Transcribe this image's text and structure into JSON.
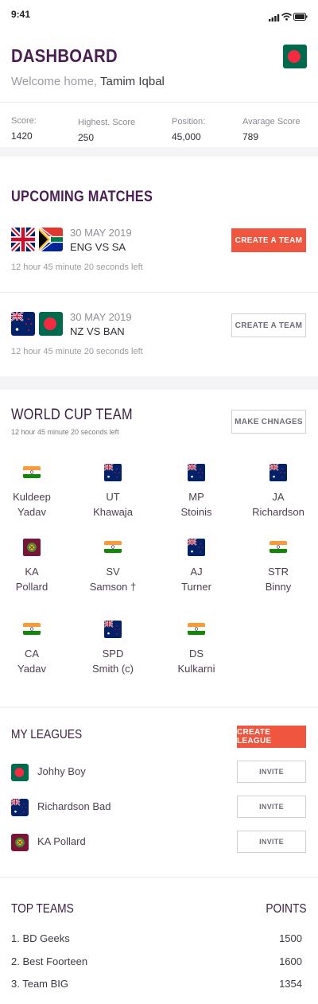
{
  "status_bar": {
    "time": "9:41"
  },
  "header": {
    "title": "DASHBOARD",
    "welcome": "Welcome home,",
    "user_name": "Tamim Iqbal"
  },
  "stats": [
    {
      "label": "Score:",
      "value": "1420"
    },
    {
      "label": "Highest. Score",
      "value": "250"
    },
    {
      "label": "Position:",
      "value": "45,000"
    },
    {
      "label": "Avarage Score",
      "value": "789"
    }
  ],
  "upcoming": {
    "title": "UPCOMING MATCHES",
    "matches": [
      {
        "date": "30 MAY 2019",
        "teams": "ENG VS SA",
        "countdown": "12 hour 45 minute 20 seconds left",
        "button": "CREATE A TEAM",
        "button_style": "solid"
      },
      {
        "date": "30 MAY 2019",
        "teams": "NZ VS BAN",
        "countdown": "12 hour 45 minute 20 seconds left",
        "button": "CREATE A TEAM",
        "button_style": "outline"
      }
    ]
  },
  "world_cup": {
    "title": "WORLD CUP TEAM",
    "countdown": "12 hour 45 minute 20 seconds left",
    "button": "MAKE CHNAGES",
    "players": [
      {
        "line1": "Kuldeep",
        "line2": "Yadav",
        "flag": "india"
      },
      {
        "line1": "UT",
        "line2": "Khawaja",
        "flag": "australia"
      },
      {
        "line1": "MP",
        "line2": "Stoinis",
        "flag": "australia"
      },
      {
        "line1": "JA",
        "line2": "Richardson",
        "flag": "australia"
      },
      {
        "line1": "KA",
        "line2": "Pollard",
        "flag": "west-indies"
      },
      {
        "line1": "SV",
        "line2": "Samson †",
        "flag": "india"
      },
      {
        "line1": "AJ",
        "line2": "Turner",
        "flag": "australia"
      },
      {
        "line1": "STR",
        "line2": "Binny",
        "flag": "india"
      },
      {
        "line1": "CA",
        "line2": "Yadav",
        "flag": "india"
      },
      {
        "line1": "SPD",
        "line2": "Smith (c)",
        "flag": "australia"
      },
      {
        "line1": "DS",
        "line2": "Kulkarni",
        "flag": "india"
      }
    ]
  },
  "leagues": {
    "title": "MY LEAGUES",
    "button": "CREATE LEAGUE",
    "items": [
      {
        "name": "Johhy Boy",
        "flag": "bangladesh",
        "button": "INVITE"
      },
      {
        "name": "Richardson Bad",
        "flag": "australia",
        "button": "INVITE"
      },
      {
        "name": "KA Pollard",
        "flag": "west-indies",
        "button": "INVITE"
      }
    ]
  },
  "top_teams": {
    "title": "TOP TEAMS",
    "points_label": "POINTS",
    "items": [
      {
        "name": "1. BD Geeks",
        "points": "1500"
      },
      {
        "name": "2. Best Foorteen",
        "points": "1600"
      },
      {
        "name": "3. Team BIG",
        "points": "1354"
      }
    ]
  },
  "colors": {
    "brand": "#4a1f52",
    "accent": "#f0563f",
    "bangladesh_green": "#006a4e",
    "bangladesh_red": "#f42a41"
  }
}
